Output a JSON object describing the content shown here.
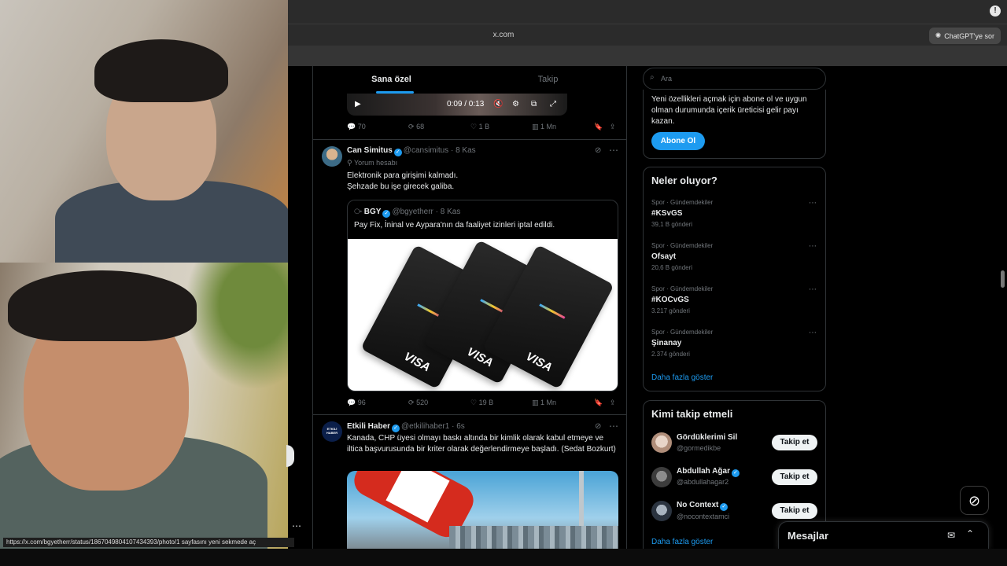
{
  "browser": {
    "url": "x.com",
    "chatgpt_button": "ChatGPT'ye sor",
    "status_url": "https://x.com/bgyetherr/status/1867049804107434393/photo/1 sayfasını yeni sekmede aç"
  },
  "timeline": {
    "tabs": [
      "Sana özel",
      "Takip"
    ],
    "video": {
      "time": "0:09 / 0:13"
    },
    "top_actions": {
      "replies": "70",
      "reposts": "68",
      "likes": "1 B",
      "views": "1 Mn"
    }
  },
  "tweet1": {
    "name": "Can Simitus",
    "handle": "@cansimitus",
    "time": "· 8 Kas",
    "label": "Yorum hesabı",
    "text_line1": "Elektronik para girişimi kalmadı.",
    "text_line2": "Şehzade bu işe girecek galiba.",
    "quote": {
      "name": "BGY",
      "handle": "@bgyetherr",
      "time": "· 8 Kas",
      "text": "Pay Fix, İninal ve Aypara'nın da faaliyet izinleri iptal edildi.",
      "card_text": "VISA"
    },
    "actions": {
      "replies": "96",
      "reposts": "520",
      "likes": "19 B",
      "views": "1 Mn"
    }
  },
  "tweet2": {
    "avatar_text": "ETKİLİ HABER",
    "name": "Etkili Haber",
    "handle": "@etkilihaber1",
    "time": "· 6s",
    "text": "Kanada, CHP üyesi olmayı baskı altında bir kimlik olarak kabul etmeye ve iltica başvurusunda bir kriter olarak değerlendirmeye başladı. (Sedat Bozkurt)"
  },
  "sidebar": {
    "search_placeholder": "Ara",
    "premium": {
      "text": "Yeni özellikleri açmak için abone ol ve uygun olman durumunda içerik üreticisi gelir payı kazan.",
      "button": "Abone Ol"
    },
    "trends": {
      "title": "Neler oluyor?",
      "items": [
        {
          "category": "Spor · Gündemdekiler",
          "name": "#KSvGS",
          "count": "39,1 B gönderi"
        },
        {
          "category": "Spor · Gündemdekiler",
          "name": "Ofsayt",
          "count": "20,6 B gönderi"
        },
        {
          "category": "Spor · Gündemdekiler",
          "name": "#KOCvGS",
          "count": "3.217 gönderi"
        },
        {
          "category": "Spor · Gündemdekiler",
          "name": "Şinanay",
          "count": "2.374 gönderi"
        }
      ],
      "show_more": "Daha fazla göster"
    },
    "who_to_follow": {
      "title": "Kimi takip etmeli",
      "users": [
        {
          "name": "Gördüklerimi Sil",
          "handle": "@gormedikbe",
          "button": "Takip et"
        },
        {
          "name": "Abdullah Ağar",
          "handle": "@abdullahagar2",
          "button": "Takip et"
        },
        {
          "name": "No Context",
          "handle": "@nocontextamci",
          "button": "Takip et"
        }
      ],
      "show_more": "Daha fazla göster"
    },
    "messages": "Mesajlar"
  },
  "colors": {
    "accent": "#1d9bf0",
    "background": "#000000",
    "border": "#2f3336"
  }
}
